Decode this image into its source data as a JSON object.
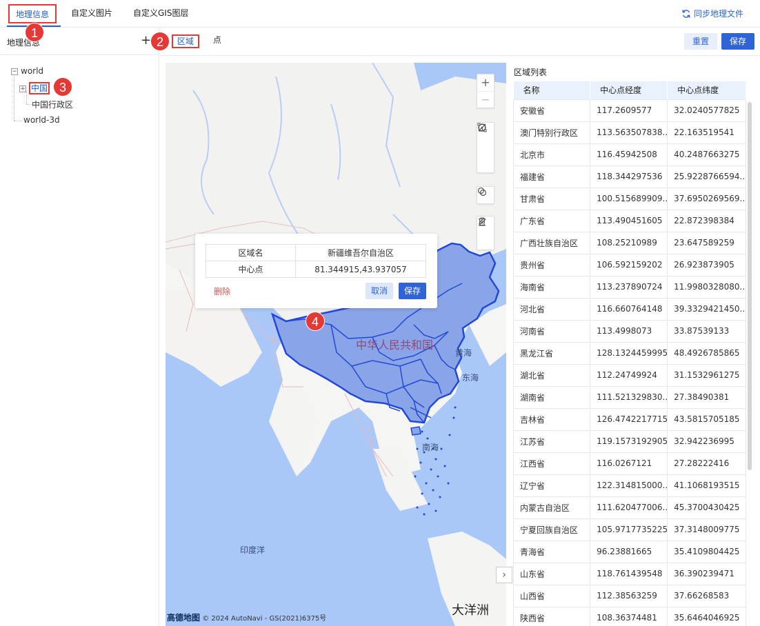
{
  "tabs": [
    "地理信息",
    "自定义图片",
    "自定义GIS图层"
  ],
  "sync_label": "同步地理文件",
  "badges": [
    "1",
    "2",
    "3",
    "4"
  ],
  "left": {
    "title": "地理信息",
    "plus": "+",
    "tree": {
      "world": "world",
      "china": "中国",
      "china_admin": "中国行政区",
      "world3d": "world-3d",
      "expanded_mark": "−",
      "collapsed_mark": "+"
    }
  },
  "subtabs": [
    "区域",
    "点"
  ],
  "buttons": {
    "reset": "重置",
    "save": "保存"
  },
  "map": {
    "labels": {
      "country": "中华人民共和国",
      "yellow_sea": "黄海",
      "east_sea": "东海",
      "south_sea": "南海",
      "indian_ocean": "印度洋",
      "oceania": "大洋洲"
    },
    "attribution_logo": "高德地图",
    "attribution": "© 2024 AutoNavi - GS(2021)6375号",
    "controls": {
      "zoom_in": "+",
      "zoom_out": "−"
    }
  },
  "popup": {
    "name_key": "区域名",
    "name_val": "新疆维吾尔自治区",
    "center_key": "中心点",
    "center_val": "81.344915,43.937057",
    "delete": "删除",
    "cancel": "取消",
    "save": "保存"
  },
  "list": {
    "title": "区域列表",
    "columns": [
      "名称",
      "中心点经度",
      "中心点纬度"
    ],
    "rows": [
      [
        "安徽省",
        "117.2609577",
        "32.0240577825"
      ],
      [
        "澳门特别行政区",
        "113.563507838...",
        "22.163519541"
      ],
      [
        "北京市",
        "116.45942508",
        "40.2487663275"
      ],
      [
        "福建省",
        "118.344297536",
        "25.9228766594..."
      ],
      [
        "甘肃省",
        "100.515689909...",
        "37.6950269569..."
      ],
      [
        "广东省",
        "113.490451605",
        "22.872398384"
      ],
      [
        "广西壮族自治区",
        "108.25210989",
        "23.647589259"
      ],
      [
        "贵州省",
        "106.592159202",
        "26.923873905"
      ],
      [
        "海南省",
        "113.237890724",
        "11.9980328080..."
      ],
      [
        "河北省",
        "116.660764148",
        "39.3329421450..."
      ],
      [
        "河南省",
        "113.4998073",
        "33.87539133"
      ],
      [
        "黑龙江省",
        "128.1324459995",
        "48.4926785865"
      ],
      [
        "湖北省",
        "112.24749924",
        "31.1532961275"
      ],
      [
        "湖南省",
        "111.521329830...",
        "27.38490381"
      ],
      [
        "吉林省",
        "126.4742217715",
        "43.5815705185"
      ],
      [
        "江苏省",
        "119.1573192905",
        "32.942236995"
      ],
      [
        "江西省",
        "116.0267121",
        "27.28222416"
      ],
      [
        "辽宁省",
        "122.314815000...",
        "41.1068193515"
      ],
      [
        "内蒙古自治区",
        "111.620477006...",
        "45.3700430425"
      ],
      [
        "宁夏回族自治区",
        "105.9717735225",
        "37.3148009775"
      ],
      [
        "青海省",
        "96.23881665",
        "35.4109804425"
      ],
      [
        "山东省",
        "118.761439548",
        "36.390239471"
      ],
      [
        "山西省",
        "112.38563259",
        "37.66268583"
      ],
      [
        "陕西省",
        "108.36374481",
        "35.6464046925"
      ]
    ]
  }
}
